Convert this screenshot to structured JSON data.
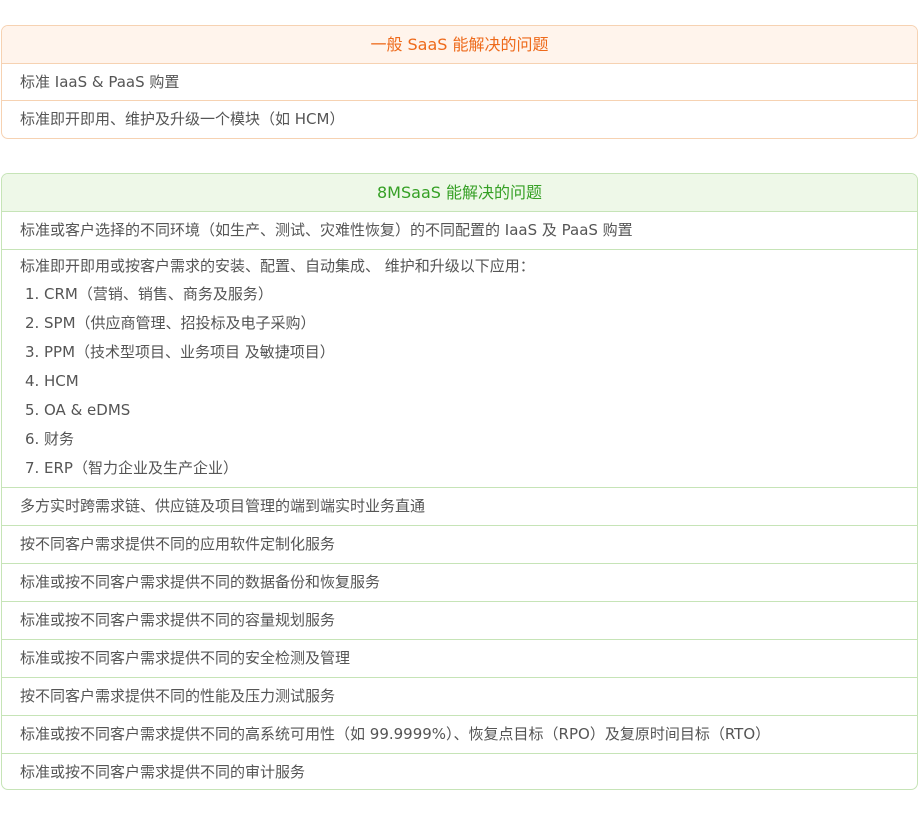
{
  "general_saas": {
    "title": "一般 SaaS 能解决的问题",
    "rows": [
      "标准 IaaS & PaaS 购置",
      "标准即开即用、维护及升级一个模块（如 HCM）"
    ]
  },
  "msaas": {
    "title": "8MSaaS 能解决的问题",
    "row1": "标准或客户选择的不同环境（如生产、测试、灾难性恢复）的不同配置的 IaaS 及 PaaS 购置",
    "apps_intro": "标准即开即用或按客户需求的安装、配置、自动集成、 维护和升级以下应用：",
    "apps": [
      {
        "num": "1.",
        "text": "CRM（营销、销售、商务及服务）"
      },
      {
        "num": "2.",
        "text": "SPM（供应商管理、招投标及电子采购）"
      },
      {
        "num": "3.",
        "text": "PPM（技术型项目、业务项目 及敏捷项目）"
      },
      {
        "num": "4.",
        "text": "HCM"
      },
      {
        "num": "5.",
        "text": "OA & eDMS"
      },
      {
        "num": "6.",
        "text": "财务"
      },
      {
        "num": "7.",
        "text": "ERP（智力企业及生产企业）"
      }
    ],
    "rows": [
      "多方实时跨需求链、供应链及项目管理的端到端实时业务直通",
      "按不同客户需求提供不同的应用软件定制化服务",
      "标准或按不同客户需求提供不同的数据备份和恢复服务",
      "标准或按不同客户需求提供不同的容量规划服务",
      "标准或按不同客户需求提供不同的安全检测及管理",
      "按不同客户需求提供不同的性能及压力测试服务",
      "标准或按不同客户需求提供不同的高系统可用性（如 99.9999%）、恢复点目标（RPO）及复原时间目标（RTO）",
      "标准或按不同客户需求提供不同的审计服务"
    ]
  }
}
